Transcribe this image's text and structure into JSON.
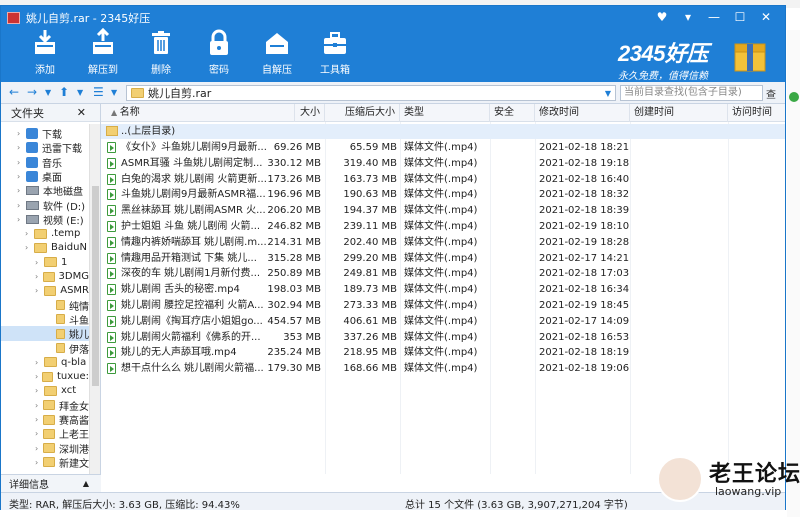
{
  "window": {
    "title": "姚儿自剪.rar - 2345好压"
  },
  "window_controls": [
    "♥",
    "▾",
    "—",
    "☐",
    "✕"
  ],
  "toolbar": [
    {
      "label": "添加",
      "icon": "add-archive-icon"
    },
    {
      "label": "解压到",
      "icon": "extract-icon"
    },
    {
      "label": "删除",
      "icon": "delete-icon"
    },
    {
      "label": "密码",
      "icon": "lock-icon"
    },
    {
      "label": "自解压",
      "icon": "self-extract-icon"
    },
    {
      "label": "工具箱",
      "icon": "toolbox-icon"
    }
  ],
  "brand": {
    "name": "2345好压",
    "slogan": "永久免费，值得信赖"
  },
  "address": {
    "path": "姚儿自剪.rar",
    "search_placeholder": "当前目录查找(包含子目录)",
    "search_button": "查找"
  },
  "tree": {
    "header": "文件夹",
    "items": [
      {
        "label": "下载",
        "depth": 1,
        "icon": "download"
      },
      {
        "label": "迅雷下载",
        "depth": 1,
        "icon": "blue"
      },
      {
        "label": "音乐",
        "depth": 1,
        "icon": "music"
      },
      {
        "label": "桌面",
        "depth": 1,
        "icon": "blue"
      },
      {
        "label": "本地磁盘",
        "depth": 1,
        "icon": "drive"
      },
      {
        "label": "软件 (D:)",
        "depth": 1,
        "icon": "drive"
      },
      {
        "label": "视频 (E:)",
        "depth": 1,
        "icon": "drive"
      },
      {
        "label": ".temp",
        "depth": 2,
        "icon": "folder"
      },
      {
        "label": "BaiduN",
        "depth": 2,
        "icon": "folder"
      },
      {
        "label": "1",
        "depth": 3,
        "icon": "folder"
      },
      {
        "label": "3DMG",
        "depth": 3,
        "icon": "folder"
      },
      {
        "label": "ASMR",
        "depth": 3,
        "icon": "folder"
      },
      {
        "label": "纯情",
        "depth": 4,
        "icon": "folder"
      },
      {
        "label": "斗鱼",
        "depth": 4,
        "icon": "folder"
      },
      {
        "label": "姚儿",
        "depth": 4,
        "icon": "folder",
        "selected": true
      },
      {
        "label": "伊落",
        "depth": 4,
        "icon": "folder"
      },
      {
        "label": "q-bla",
        "depth": 3,
        "icon": "folder"
      },
      {
        "label": "tuxue:",
        "depth": 3,
        "icon": "folder"
      },
      {
        "label": "xct",
        "depth": 3,
        "icon": "folder"
      },
      {
        "label": "拜金女",
        "depth": 3,
        "icon": "folder"
      },
      {
        "label": "赛高酱",
        "depth": 3,
        "icon": "folder"
      },
      {
        "label": "上老王",
        "depth": 3,
        "icon": "folder"
      },
      {
        "label": "深圳港",
        "depth": 3,
        "icon": "folder"
      },
      {
        "label": "新建文",
        "depth": 3,
        "icon": "folder"
      }
    ]
  },
  "columns": {
    "name": "名称",
    "size": "大小",
    "packed": "压缩后大小",
    "type": "类型",
    "security": "安全",
    "modified": "修改时间",
    "created": "创建时间",
    "accessed": "访问时间"
  },
  "up_row": {
    "name": "..(上层目录)"
  },
  "files": [
    {
      "name": "《女仆》斗鱼姚儿剧闹9月最新...",
      "size": "69.26 MB",
      "packed": "65.59 MB",
      "type": "媒体文件(.mp4)",
      "modified": "2021-02-18 18:21:..."
    },
    {
      "name": "ASMR耳骚 斗鱼姚儿剧闹定制...",
      "size": "330.12 MB",
      "packed": "319.40 MB",
      "type": "媒体文件(.mp4)",
      "modified": "2021-02-18 19:18:..."
    },
    {
      "name": "白兔的渴求 姚儿剧闹 火箭更新...",
      "size": "173.26 MB",
      "packed": "163.73 MB",
      "type": "媒体文件(.mp4)",
      "modified": "2021-02-18 16:40:..."
    },
    {
      "name": "斗鱼姚儿剧闹9月最新ASMR福...",
      "size": "196.96 MB",
      "packed": "190.63 MB",
      "type": "媒体文件(.mp4)",
      "modified": "2021-02-18 18:32:..."
    },
    {
      "name": "黑丝袜舔耳 姚儿剧闹ASMR 火...",
      "size": "206.20 MB",
      "packed": "194.37 MB",
      "type": "媒体文件(.mp4)",
      "modified": "2021-02-18 18:39:..."
    },
    {
      "name": "护士姐姐 斗鱼 姚儿剧闹 火箭...",
      "size": "246.82 MB",
      "packed": "239.11 MB",
      "type": "媒体文件(.mp4)",
      "modified": "2021-02-19 18:10:..."
    },
    {
      "name": "情趣内裤娇喘舔耳 姚儿剧闹.m...",
      "size": "214.31 MB",
      "packed": "202.40 MB",
      "type": "媒体文件(.mp4)",
      "modified": "2021-02-19 18:28:..."
    },
    {
      "name": "情趣用品开箱测试 下集 姚儿...",
      "size": "315.28 MB",
      "packed": "299.20 MB",
      "type": "媒体文件(.mp4)",
      "modified": "2021-02-17 14:21:..."
    },
    {
      "name": "深夜的车 姚儿剧闹1月新付费...",
      "size": "250.89 MB",
      "packed": "249.81 MB",
      "type": "媒体文件(.mp4)",
      "modified": "2021-02-18 17:03:..."
    },
    {
      "name": "姚儿剧闹 舌头的秘密.mp4",
      "size": "198.03 MB",
      "packed": "189.73 MB",
      "type": "媒体文件(.mp4)",
      "modified": "2021-02-18 16:34:..."
    },
    {
      "name": "姚儿剧闹 腰控足控福利 火箭A...",
      "size": "302.94 MB",
      "packed": "273.33 MB",
      "type": "媒体文件(.mp4)",
      "modified": "2021-02-19 18:45:..."
    },
    {
      "name": "姚儿剧闹《掏耳疗店小姐姐go...",
      "size": "454.57 MB",
      "packed": "406.61 MB",
      "type": "媒体文件(.mp4)",
      "modified": "2021-02-17 14:09:..."
    },
    {
      "name": "姚儿剧闹火箭福利《佛系的开...",
      "size": "353 MB",
      "packed": "337.26 MB",
      "type": "媒体文件(.mp4)",
      "modified": "2021-02-18 16:53:..."
    },
    {
      "name": "姚儿的无人声舔耳哦.mp4",
      "size": "235.24 MB",
      "packed": "218.95 MB",
      "type": "媒体文件(.mp4)",
      "modified": "2021-02-18 18:19:..."
    },
    {
      "name": "想干点什么么 姚儿剧闹火箭福...",
      "size": "179.30 MB",
      "packed": "168.66 MB",
      "type": "媒体文件(.mp4)",
      "modified": "2021-02-18 19:06:..."
    }
  ],
  "details_pane": {
    "label": "详细信息"
  },
  "status": {
    "left": "类型: RAR, 解压后大小: 3.63 GB, 压缩比: 94.43%",
    "right": "总计 15 个文件 (3.63 GB, 3,907,271,204 字节)"
  },
  "watermark": {
    "title": "老王论坛",
    "url": "laowang.vip"
  },
  "colors": {
    "toolbar_blue": "#1f7fd6",
    "selection": "#cfe3f8"
  }
}
